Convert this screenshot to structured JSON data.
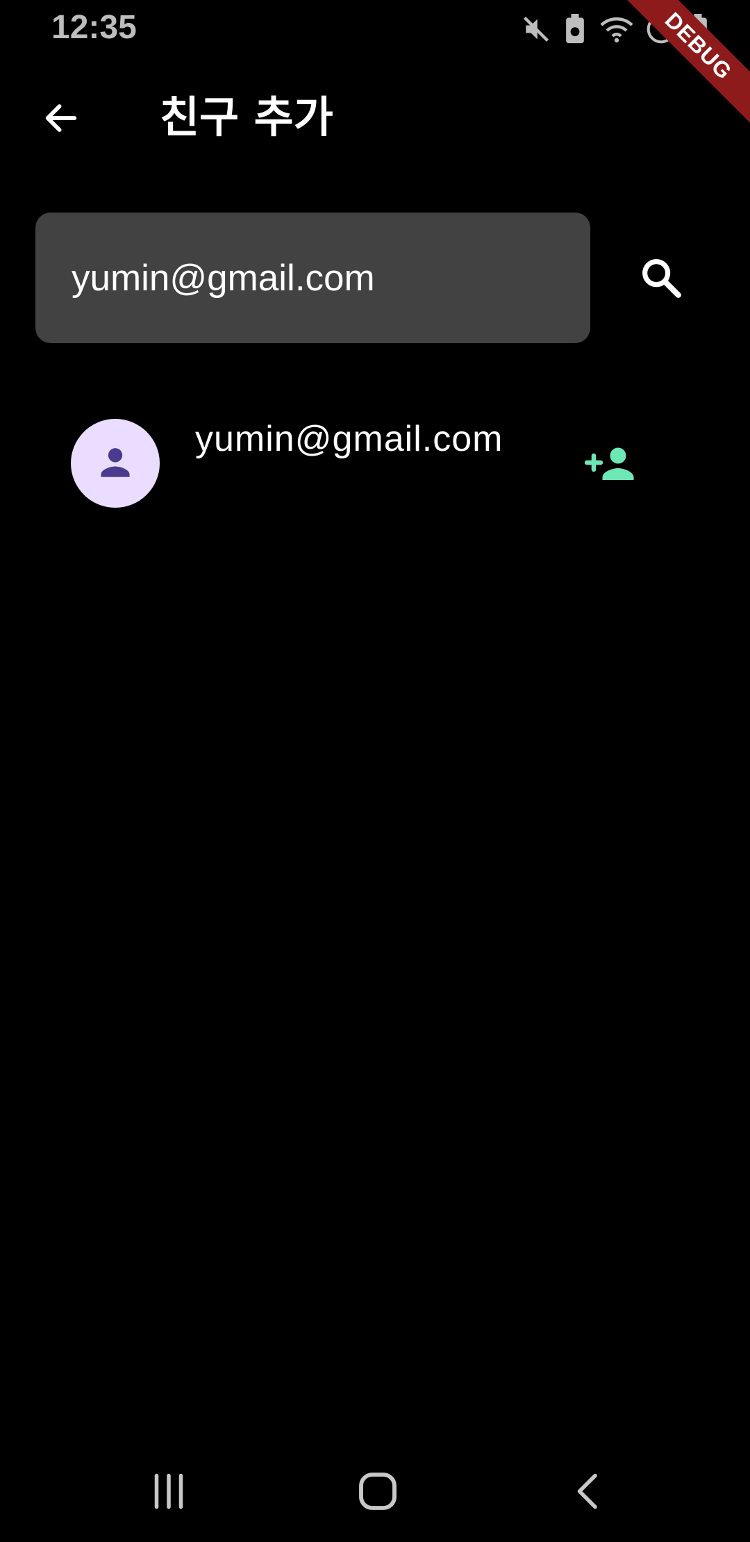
{
  "status_bar": {
    "time": "12:35",
    "icons": [
      "mute-icon",
      "battery-saver-icon",
      "wifi-icon",
      "do-not-disturb-icon",
      "battery-icon"
    ]
  },
  "debug_banner": "DEBUG",
  "app_bar": {
    "back_icon": "arrow-back-icon",
    "title": "친구 추가"
  },
  "search": {
    "value": "yumin@gmail.com",
    "button_icon": "search-icon"
  },
  "results": [
    {
      "avatar_icon": "person-icon",
      "email": "yumin@gmail.com",
      "action_icon": "person-add-icon"
    }
  ],
  "nav_bar": {
    "icons": [
      "recent-apps-icon",
      "home-icon",
      "back-icon"
    ]
  },
  "colors": {
    "background": "#000000",
    "search_field": "#424242",
    "avatar_bg": "#eaddff",
    "avatar_icon": "#4a3b8f",
    "add_friend": "#6ee7b7",
    "debug_ribbon": "#8e1b1b",
    "status_text": "#bdbdbd"
  }
}
